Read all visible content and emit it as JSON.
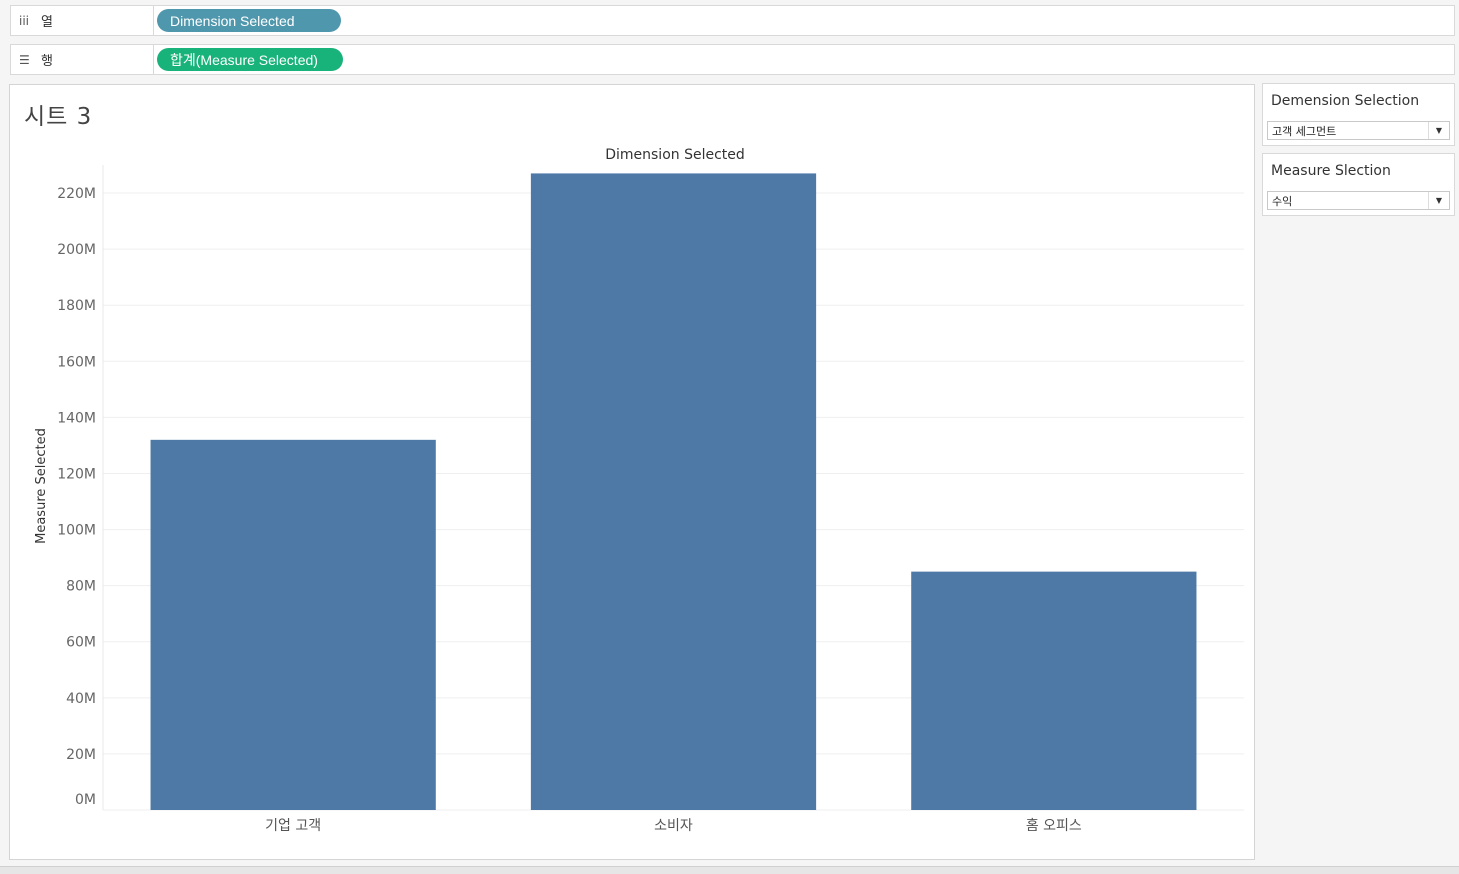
{
  "shelves": {
    "columns": {
      "icon": "columns-icon",
      "label": "열",
      "pill": "Dimension Selected",
      "pill_color": "#4f97ad"
    },
    "rows": {
      "icon": "rows-icon",
      "label": "행",
      "pill": "합계(Measure Selected)",
      "pill_color": "#18b37a"
    }
  },
  "sheet": {
    "title": "시트 3"
  },
  "parameters": [
    {
      "title": "Demension Selection",
      "value": "고객 세그먼트"
    },
    {
      "title": "Measure Slection",
      "value": "수익"
    }
  ],
  "chart_data": {
    "type": "bar",
    "title": "Dimension Selected",
    "xlabel": "",
    "ylabel": "Measure Selected",
    "categories": [
      "기업 고객",
      "소비자",
      "홈 오피스"
    ],
    "values": [
      132,
      227,
      85
    ],
    "unit": "M",
    "ylim": [
      0,
      230
    ],
    "yticks": [
      0,
      20,
      40,
      60,
      80,
      100,
      120,
      140,
      160,
      180,
      200,
      220
    ],
    "ytick_labels": [
      "0M",
      "20M",
      "40M",
      "60M",
      "80M",
      "100M",
      "120M",
      "140M",
      "160M",
      "180M",
      "200M",
      "220M"
    ],
    "grid": true,
    "bar_color": "#4e79a7"
  }
}
